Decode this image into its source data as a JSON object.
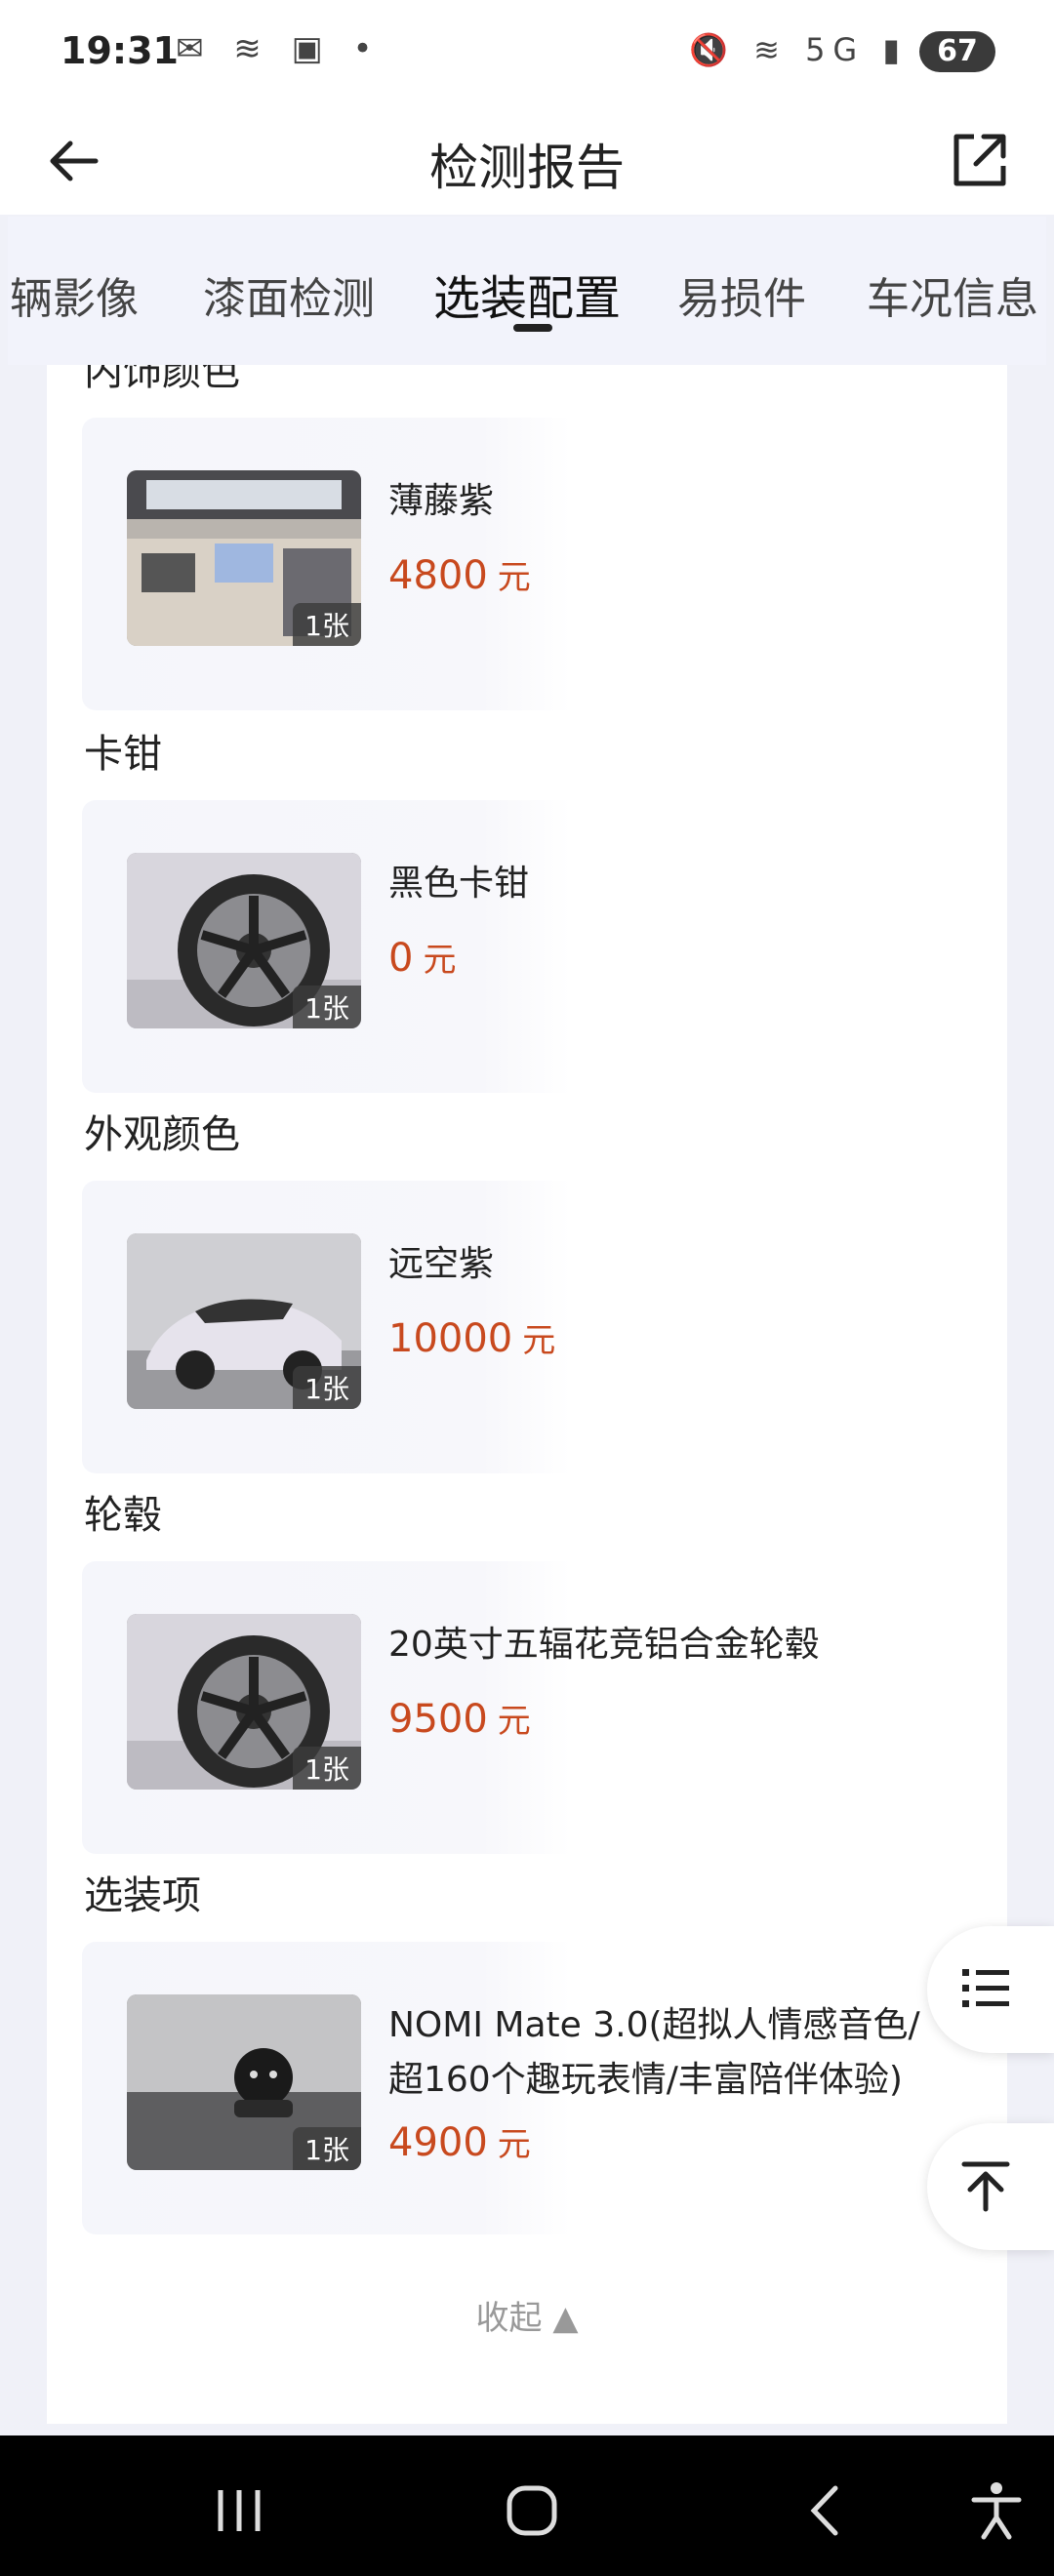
{
  "status_bar": {
    "time": "19:31",
    "network": "5G",
    "battery": "67"
  },
  "header": {
    "title": "检测报告"
  },
  "tabs": [
    {
      "label": "辆影像"
    },
    {
      "label": "漆面检测"
    },
    {
      "label": "选装配置",
      "active": true
    },
    {
      "label": "易损件"
    },
    {
      "label": "车况信息"
    }
  ],
  "sections": [
    {
      "title": "内饰颜色",
      "item": {
        "name": "薄藤紫",
        "price": "4800",
        "unit": "元",
        "photo_count": "1张"
      }
    },
    {
      "title": "卡钳",
      "item": {
        "name": "黑色卡钳",
        "price": "0",
        "unit": "元",
        "photo_count": "1张"
      }
    },
    {
      "title": "外观颜色",
      "item": {
        "name": "远空紫",
        "price": "10000",
        "unit": "元",
        "photo_count": "1张"
      }
    },
    {
      "title": "轮毂",
      "item": {
        "name": "20英寸五辐花竞铝合金轮毂",
        "price": "9500",
        "unit": "元",
        "photo_count": "1张"
      }
    },
    {
      "title": "选装项",
      "item": {
        "name": "NOMI Mate 3.0(超拟人情感音色/超160个趣玩表情/丰富陪伴体验)",
        "price": "4900",
        "unit": "元",
        "photo_count": "1张"
      }
    }
  ],
  "collapse_label": "收起 ▲",
  "colors": {
    "price": "#c8491e",
    "accent_tab": "#222222"
  }
}
